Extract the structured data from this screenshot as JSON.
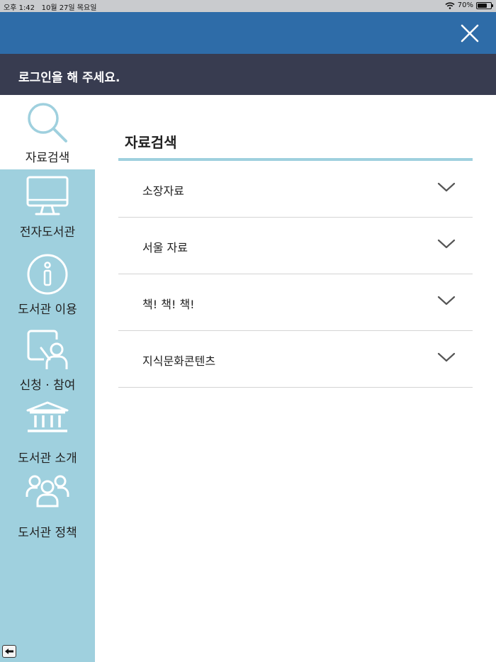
{
  "status": {
    "time": "오후 1:42",
    "date": "10월 27일 목요일",
    "battery": "70%",
    "battery_level": 0.7
  },
  "header": {
    "close_icon": "close-icon"
  },
  "login": {
    "prompt": "로그인을 해 주세요."
  },
  "sidebar": {
    "items": [
      {
        "label": "자료검색",
        "icon": "search-icon",
        "active": true
      },
      {
        "label": "전자도서관",
        "icon": "monitor-icon",
        "active": false
      },
      {
        "label": "도서관 이용",
        "icon": "info-icon",
        "active": false
      },
      {
        "label": "신청 · 참여",
        "icon": "request-icon",
        "active": false
      },
      {
        "label": "도서관 소개",
        "icon": "library-building-icon",
        "active": false
      },
      {
        "label": "도서관 정책",
        "icon": "people-group-icon",
        "active": false
      }
    ],
    "back_icon": "arrow-left-icon"
  },
  "main": {
    "title": "자료검색",
    "accordion": [
      {
        "label": "소장자료"
      },
      {
        "label": "서울 자료"
      },
      {
        "label": "책! 책! 책!"
      },
      {
        "label": "지식문화콘텐츠"
      }
    ]
  },
  "colors": {
    "header_blue": "#2e6ca8",
    "login_bar": "#383c50",
    "sidebar_bg": "#9fd0de",
    "accent_line": "#9fd0de"
  }
}
